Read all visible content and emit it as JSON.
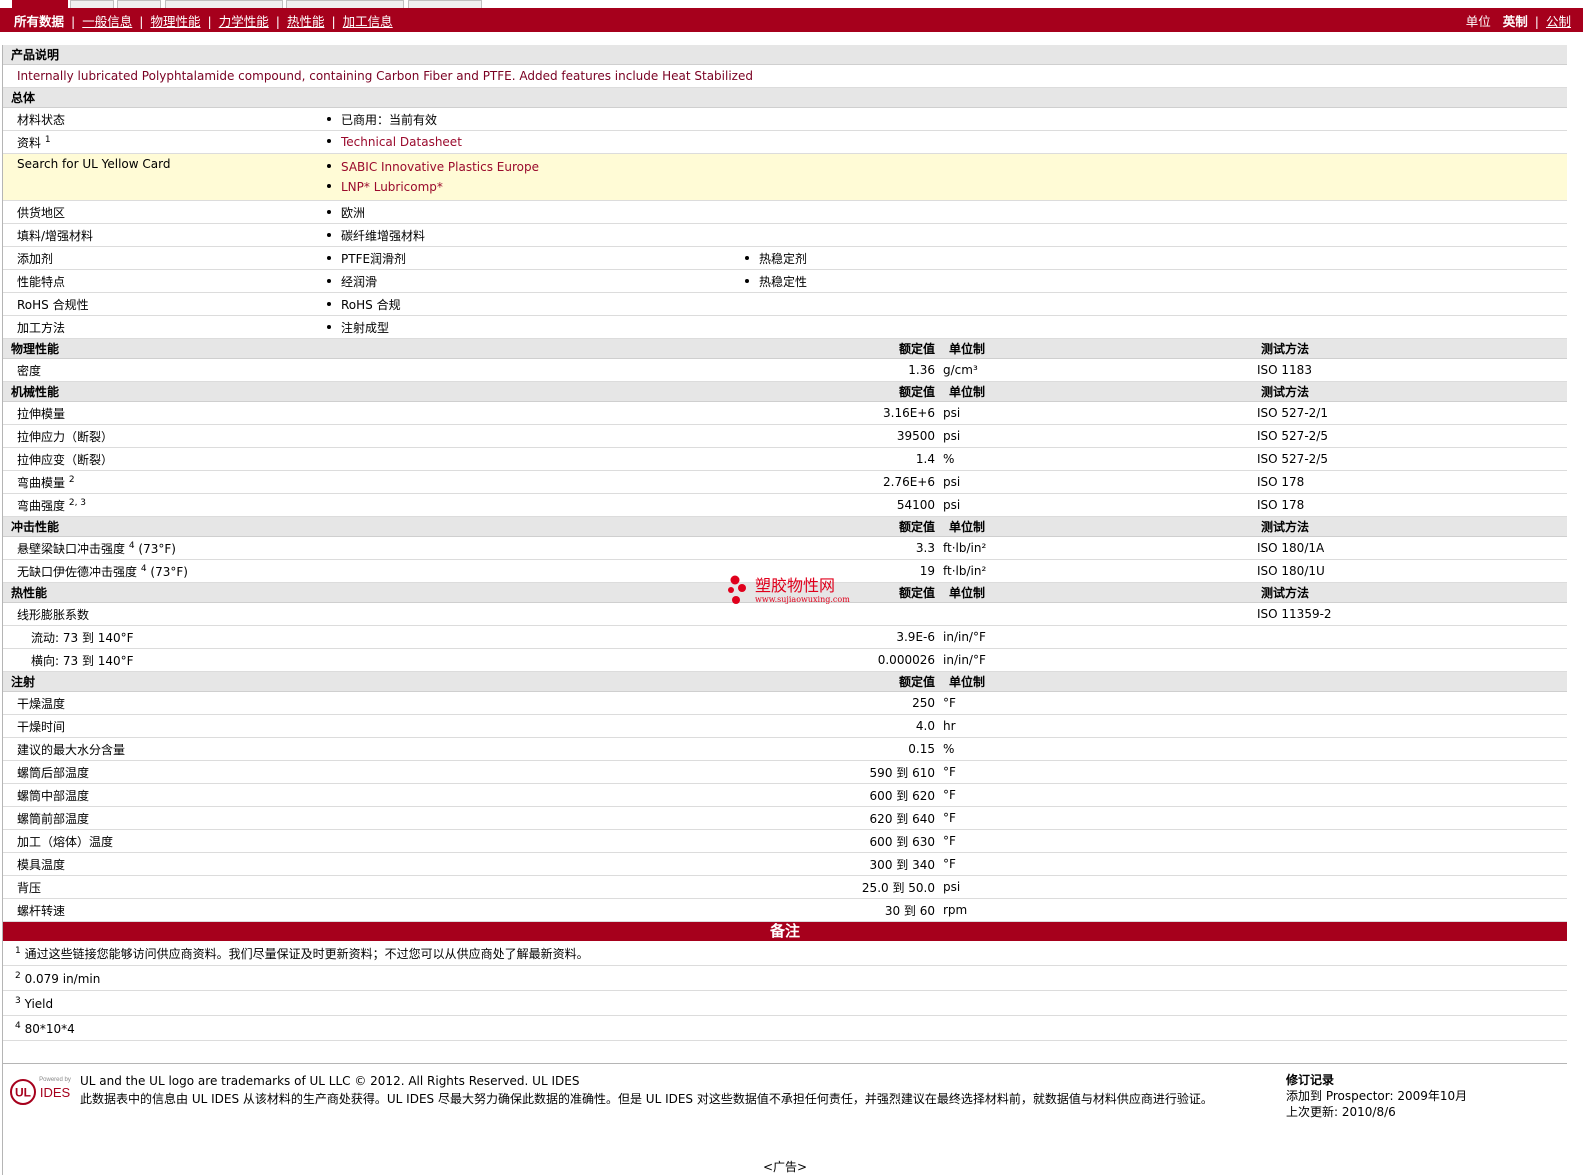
{
  "nav": {
    "items": [
      "所有数据",
      "一般信息",
      "物理性能",
      "力学性能",
      "热性能",
      "加工信息"
    ],
    "units_label": "单位",
    "unit_english": "英制",
    "unit_metric": "公制"
  },
  "product": {
    "heading": "产品说明",
    "description": "Internally lubricated Polyphtalamide compound, containing Carbon Fiber and PTFE. Added features include Heat Stabilized"
  },
  "general": {
    "heading": "总体",
    "material_status": {
      "label": "材料状态",
      "value": "已商用：当前有效"
    },
    "docs": {
      "label": "资料",
      "sup": "1",
      "value": "Technical Datasheet"
    },
    "ul": {
      "label": "Search for UL Yellow Card",
      "v1": "SABIC Innovative Plastics Europe",
      "v2": "LNP* Lubricomp*"
    },
    "region": {
      "label": "供货地区",
      "value": "欧洲"
    },
    "filler": {
      "label": "填料/增强材料",
      "value": "碳纤维增强材料"
    },
    "additive": {
      "label": "添加剂",
      "v1": "PTFE润滑剂",
      "v2": "热稳定剂"
    },
    "features": {
      "label": "性能特点",
      "v1": "经润滑",
      "v2": "热稳定性"
    },
    "rohs": {
      "label": "RoHS 合规性",
      "value": "RoHS 合规"
    },
    "process": {
      "label": "加工方法",
      "value": "注射成型"
    }
  },
  "col": {
    "nominal": "额定值",
    "unit": "单位制",
    "method": "测试方法"
  },
  "physical": {
    "heading": "物理性能",
    "density": {
      "label": "密度",
      "value": "1.36",
      "unit": "g/cm³",
      "method": "ISO 1183"
    }
  },
  "mechanical": {
    "heading": "机械性能",
    "rows": [
      {
        "label": "拉伸模量",
        "sup": "",
        "value": "3.16E+6",
        "unit": "psi",
        "method": "ISO 527-2/1"
      },
      {
        "label": "拉伸应力（断裂）",
        "sup": "",
        "value": "39500",
        "unit": "psi",
        "method": "ISO 527-2/5"
      },
      {
        "label": "拉伸应变（断裂）",
        "sup": "",
        "value": "1.4",
        "unit": "%",
        "method": "ISO 527-2/5"
      },
      {
        "label": "弯曲模量",
        "sup": "2",
        "value": "2.76E+6",
        "unit": "psi",
        "method": "ISO 178"
      },
      {
        "label": "弯曲强度",
        "sup": "2, 3",
        "value": "54100",
        "unit": "psi",
        "method": "ISO 178"
      }
    ]
  },
  "impact": {
    "heading": "冲击性能",
    "rows": [
      {
        "label": "悬壁梁缺口冲击强度",
        "sup": "4",
        "suffix": "(73°F)",
        "value": "3.3",
        "unit": "ft·lb/in²",
        "method": "ISO 180/1A"
      },
      {
        "label": "无缺口伊佐德冲击强度",
        "sup": "4",
        "suffix": "(73°F)",
        "value": "19",
        "unit": "ft·lb/in²",
        "method": "ISO 180/1U"
      }
    ]
  },
  "thermal": {
    "heading": "热性能",
    "cte": {
      "label": "线形膨胀系数",
      "method": "ISO 11359-2"
    },
    "flow": {
      "label": "流动: 73 到  140°F",
      "value": "3.9E-6",
      "unit": "in/in/°F"
    },
    "cross": {
      "label": "横向: 73 到  140°F",
      "value": "0.000026",
      "unit": "in/in/°F"
    }
  },
  "injection": {
    "heading": "注射",
    "rows": [
      {
        "label": "干燥温度",
        "value": "250",
        "unit": "°F"
      },
      {
        "label": "干燥时间",
        "value": "4.0",
        "unit": "hr"
      },
      {
        "label": "建议的最大水分含量",
        "value": "0.15",
        "unit": "%"
      },
      {
        "label": "螺筒后部温度",
        "value": "590 到  610",
        "unit": "°F"
      },
      {
        "label": "螺筒中部温度",
        "value": "600 到  620",
        "unit": "°F"
      },
      {
        "label": "螺筒前部温度",
        "value": "620 到  640",
        "unit": "°F"
      },
      {
        "label": "加工（熔体）温度",
        "value": "600 到  630",
        "unit": "°F"
      },
      {
        "label": "模具温度",
        "value": "300 到  340",
        "unit": "°F"
      },
      {
        "label": "背压",
        "value": "25.0 到  50.0",
        "unit": "psi"
      },
      {
        "label": "螺杆转速",
        "value": "30 到  60",
        "unit": "rpm"
      }
    ]
  },
  "notes": {
    "heading": "备注",
    "items": [
      {
        "n": "1",
        "text": "通过这些链接您能够访问供应商资料。我们尽量保证及时更新资料；不过您可以从供应商处了解最新资料。"
      },
      {
        "n": "2",
        "text": "0.079 in/min"
      },
      {
        "n": "3",
        "text": "Yield"
      },
      {
        "n": "4",
        "text": "80*10*4"
      }
    ]
  },
  "watermark": {
    "title": "塑胶物性网",
    "url": "www.sujiaowuxing.com"
  },
  "footer": {
    "logo_ul": "UL",
    "logo_small": "Powered by",
    "logo_ides": "IDES",
    "line1": "UL and the UL logo are trademarks of UL LLC © 2012. All Rights Reserved. UL IDES",
    "line2": "此数据表中的信息由  UL IDES 从该材料的生产商处获得。UL IDES 尽最大努力确保此数据的准确性。但是  UL IDES 对这些数据值不承担任何责任，并强烈建议在最终选择材料前，就数据值与材料供应商进行验证。",
    "rev_title": "修订记录",
    "rev_added": "添加到  Prospector:    2009年10月",
    "rev_updated": "上次更新:    2010/8/6",
    "ad": "<广告>"
  },
  "colors": {
    "brand": "#a6001c",
    "link": "#9a0a2c",
    "highlight": "#fffbd6",
    "section": "#e6e6e6"
  }
}
